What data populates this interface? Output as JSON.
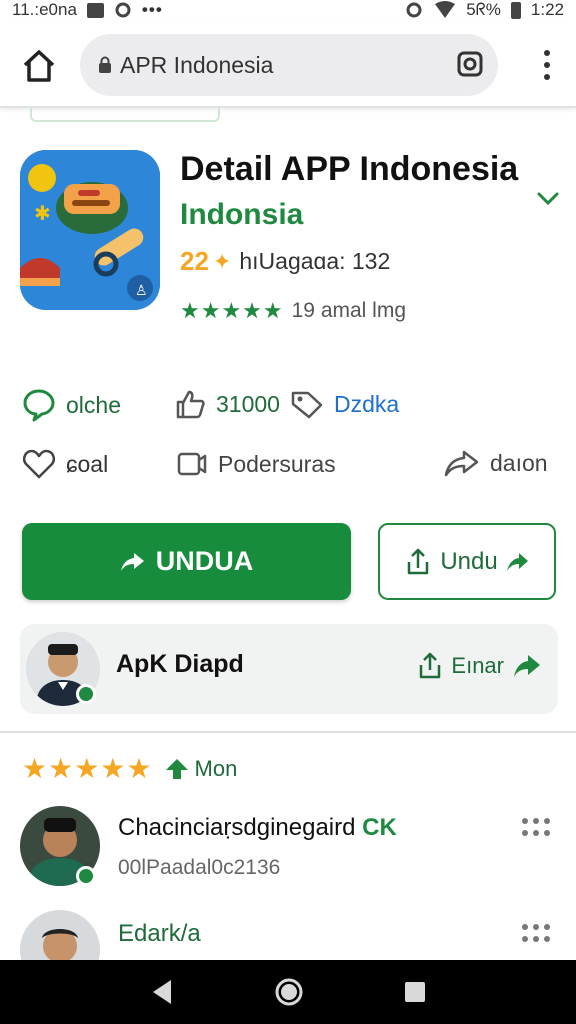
{
  "status_bar": {
    "carrier": "11.:e0na",
    "battery": "5ᖇ%",
    "time": "1:22"
  },
  "address_bar": {
    "url": "APR Indonesia",
    "icons": [
      "home-icon",
      "lock-icon",
      "camera-icon",
      "overflow-menu-icon"
    ]
  },
  "app": {
    "title": "Detail APP Indonesia",
    "subtitle": "Indonsia",
    "rating_value": "22",
    "rating_label": "hıUagaɑa: 132",
    "stars": "★★★★★",
    "stars_label": "19 amal lmg"
  },
  "meta": {
    "chat_label": "olche",
    "likes_label": "31000",
    "tag_label": "Dzdka",
    "heart_label": "ɕoal",
    "podcast_label": "Podersuras",
    "share_label": "daıon"
  },
  "actions": {
    "primary_label": "UNDUA",
    "secondary_label": "Undu"
  },
  "developer": {
    "name": "ApK Diapd",
    "action_label": "Eınar"
  },
  "reviews_header": {
    "stars": "★★★★★",
    "more_label": "Mon"
  },
  "reviews": [
    {
      "name": "Chacinciaṛsdginegaird",
      "tag": "CK",
      "meta": "00lPaadal0c2136"
    },
    {
      "name": "Edark/a",
      "tag": "",
      "meta": ""
    }
  ],
  "colors": {
    "brand_green": "#168c3c",
    "accent_orange": "#f5a623",
    "link_blue": "#1d6fd1"
  }
}
